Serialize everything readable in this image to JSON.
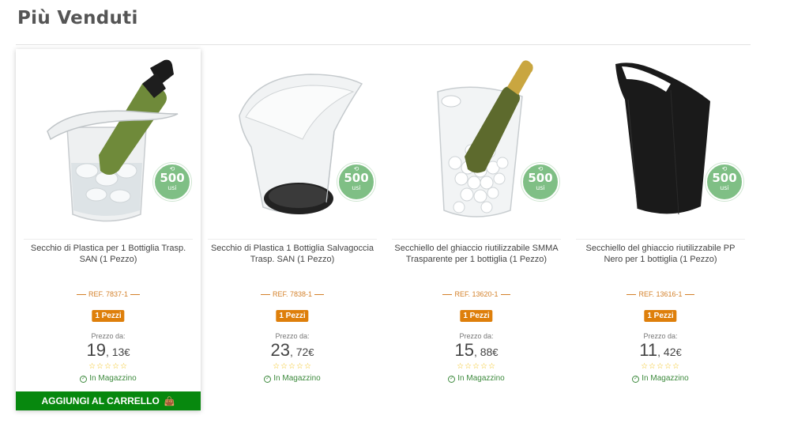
{
  "section": {
    "title": "Più Venduti"
  },
  "badge": {
    "value": "500",
    "unit": "usi",
    "icon": "recycle-icon",
    "color": "#7fbf85"
  },
  "labels": {
    "price_from": "Prezzo da:",
    "in_stock": "In Magazzino",
    "add_to_cart": "AGGIUNGI AL CARRELLO",
    "currency": "€"
  },
  "colors": {
    "accent": "#de7f0b",
    "cart_button": "#07880e",
    "stock": "#3d8a3d",
    "stars": "#f1c21b"
  },
  "products": [
    {
      "name": "Secchio di Plastica per 1 Bottiglia Trasp. SAN (1 Pezzo)",
      "ref": "REF. 7837-1",
      "pack": "1 Pezzi",
      "price_int": "19",
      "price_dec": "13",
      "stars": "☆☆☆☆☆",
      "rating": 0,
      "hovered": true
    },
    {
      "name": "Secchio di Plastica 1 Bottiglia Salvagoccia Trasp. SAN (1 Pezzo)",
      "ref": "REF. 7838-1",
      "pack": "1 Pezzi",
      "price_int": "23",
      "price_dec": "72",
      "stars": "☆☆☆☆☆",
      "rating": 0,
      "hovered": false
    },
    {
      "name": "Secchiello del ghiaccio riutilizzabile SMMA Trasparente per 1 bottiglia (1 Pezzo)",
      "ref": "REF. 13620-1",
      "pack": "1 Pezzi",
      "price_int": "15",
      "price_dec": "88",
      "stars": "☆☆☆☆☆",
      "rating": 0,
      "hovered": false
    },
    {
      "name": "Secchiello del ghiaccio riutilizzabile PP Nero per 1 bottiglia (1 Pezzo)",
      "ref": "REF. 13616-1",
      "pack": "1 Pezzi",
      "price_int": "11",
      "price_dec": "42",
      "stars": "☆☆☆☆☆",
      "rating": 0,
      "hovered": false
    }
  ]
}
